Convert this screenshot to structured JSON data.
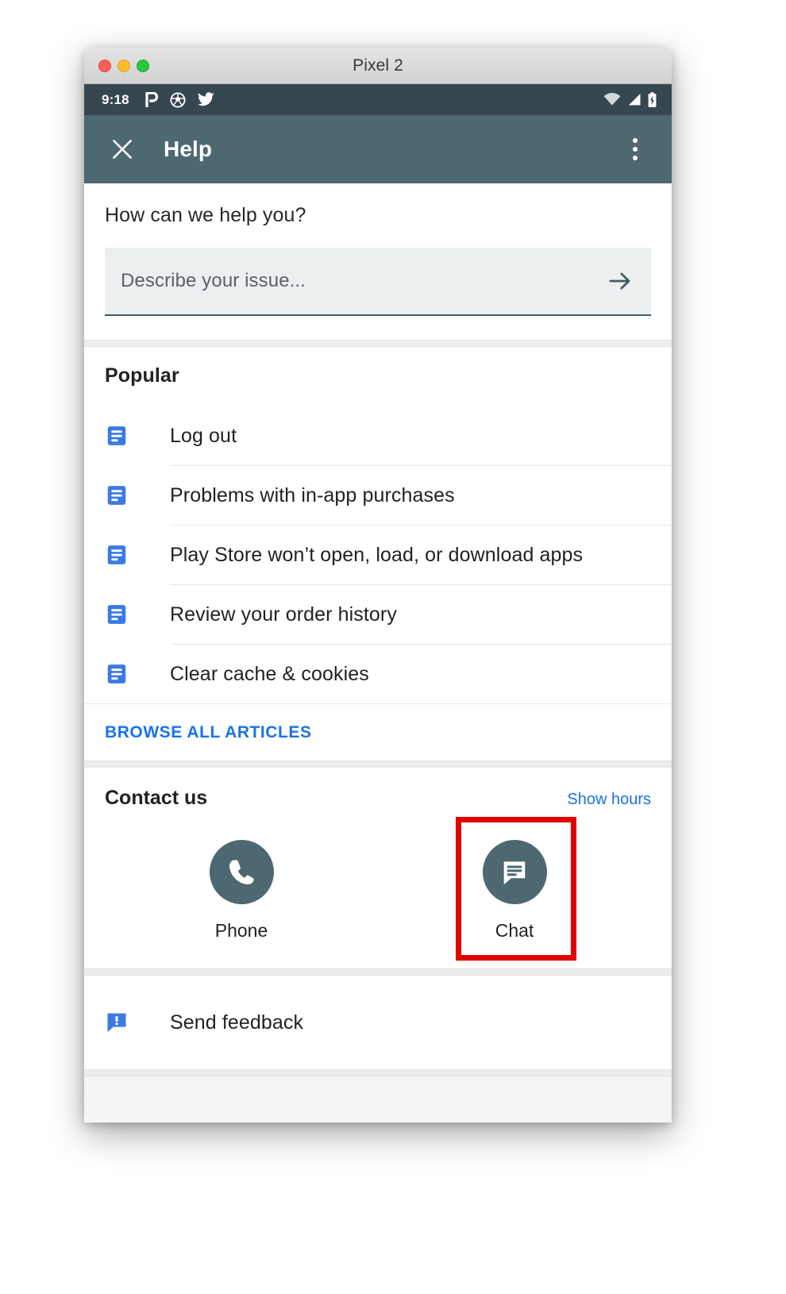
{
  "window": {
    "title": "Pixel 2",
    "traffic_lights": [
      "close",
      "minimize",
      "zoom"
    ]
  },
  "status_bar": {
    "time": "9:18",
    "left_icons": [
      "pocketcasts-icon",
      "soccer-ball-icon",
      "twitter-icon"
    ],
    "right_icons": [
      "wifi-icon",
      "cellular-signal-icon",
      "battery-charging-icon"
    ]
  },
  "app_bar": {
    "close_icon": "close-icon",
    "title": "Help",
    "overflow_icon": "overflow-menu-icon",
    "background": "#4d6870"
  },
  "search": {
    "heading": "How can we help you?",
    "placeholder": "Describe your issue...",
    "value": "",
    "submit_icon": "arrow-right-icon"
  },
  "popular": {
    "heading": "Popular",
    "articles": [
      {
        "label": "Log out",
        "icon": "article-icon"
      },
      {
        "label": "Problems with in-app purchases",
        "icon": "article-icon"
      },
      {
        "label": "Play Store won’t open, load, or download apps",
        "icon": "article-icon"
      },
      {
        "label": "Review your order history",
        "icon": "article-icon"
      },
      {
        "label": "Clear cache & cookies",
        "icon": "article-icon"
      }
    ],
    "browse_all_label": "BROWSE ALL ARTICLES",
    "link_color": "#1a73e8"
  },
  "contact": {
    "heading": "Contact us",
    "show_hours_label": "Show hours",
    "options": [
      {
        "label": "Phone",
        "icon": "phone-icon"
      },
      {
        "label": "Chat",
        "icon": "chat-bubble-icon"
      }
    ],
    "highlighted_option": "Chat",
    "highlight_color": "#e00000",
    "circle_color": "#4d6870"
  },
  "feedback": {
    "label": "Send feedback",
    "icon": "feedback-bubble-icon"
  },
  "nav_bar": {
    "back_icon": "chevron-left-icon",
    "home_icon": "home-pill-icon"
  }
}
